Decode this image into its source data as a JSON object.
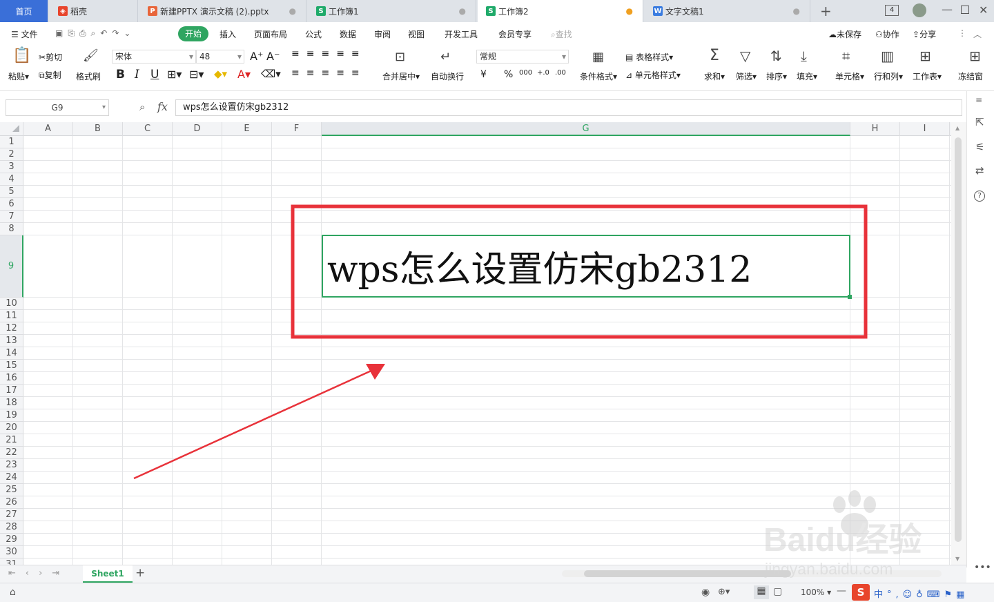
{
  "tabs": [
    {
      "label": "首页"
    },
    {
      "label": "稻壳",
      "icon": "daoke-icon",
      "color": "#e8452c"
    },
    {
      "label": "新建PPTX 演示文稿 (2).pptx",
      "icon": "P",
      "color": "#e8653a"
    },
    {
      "label": "工作簿1",
      "icon": "S",
      "color": "#1faa6a"
    },
    {
      "label": "工作簿2",
      "icon": "S",
      "color": "#1faa6a"
    },
    {
      "label": "文字文稿1",
      "icon": "W",
      "color": "#3a7ce0"
    }
  ],
  "tab_counter": "4",
  "menu": {
    "file": "文件",
    "items": [
      "开始",
      "插入",
      "页面布局",
      "公式",
      "数据",
      "审阅",
      "视图",
      "开发工具",
      "会员专享"
    ],
    "search": "查找",
    "unsaved": "未保存",
    "collab": "协作",
    "share": "分享"
  },
  "ribbon": {
    "paste": "粘贴",
    "cut": "剪切",
    "copy": "复制",
    "format_painter": "格式刷",
    "font_name": "宋体",
    "font_size": "48",
    "bold": "B",
    "italic": "I",
    "underline": "U",
    "merge_center": "合并居中",
    "wrap": "自动换行",
    "number_format": "常规",
    "currency": "¥",
    "percent": "%",
    "thousands": "000",
    "dec_inc": "+.0",
    "dec_dec": ".00",
    "cond_format": "条件格式",
    "table_style": "表格样式",
    "cell_style": "单元格样式",
    "sum": "求和",
    "filter": "筛选",
    "sort": "排序",
    "fill": "填充",
    "cell": "单元格",
    "row_col": "行和列",
    "worksheet": "工作表",
    "freeze": "冻结窗"
  },
  "formula_bar": {
    "cell_ref": "G9",
    "fx": "fx",
    "content": "wps怎么设置仿宋gb2312"
  },
  "columns": [
    "A",
    "B",
    "C",
    "D",
    "E",
    "F",
    "G",
    "H",
    "I"
  ],
  "selected_column": "G",
  "rows": [
    "1",
    "2",
    "3",
    "4",
    "5",
    "6",
    "7",
    "8",
    "9",
    "10",
    "11",
    "12",
    "13",
    "14",
    "15",
    "16",
    "17",
    "18",
    "19",
    "20",
    "21",
    "22",
    "23",
    "24",
    "25",
    "26",
    "27",
    "28",
    "29",
    "30",
    "31"
  ],
  "selected_row": "9",
  "cell_text": "wps怎么设置仿宋gb2312",
  "sheet": {
    "name": "Sheet1",
    "add": "+"
  },
  "status": {
    "zoom": "100%"
  },
  "watermark": {
    "brand": "Baidu经验",
    "url": "jingyan.baidu.com"
  },
  "colors": {
    "accent": "#2fa561",
    "annotation": "#e8323a",
    "home_tab": "#3a6fd8"
  }
}
